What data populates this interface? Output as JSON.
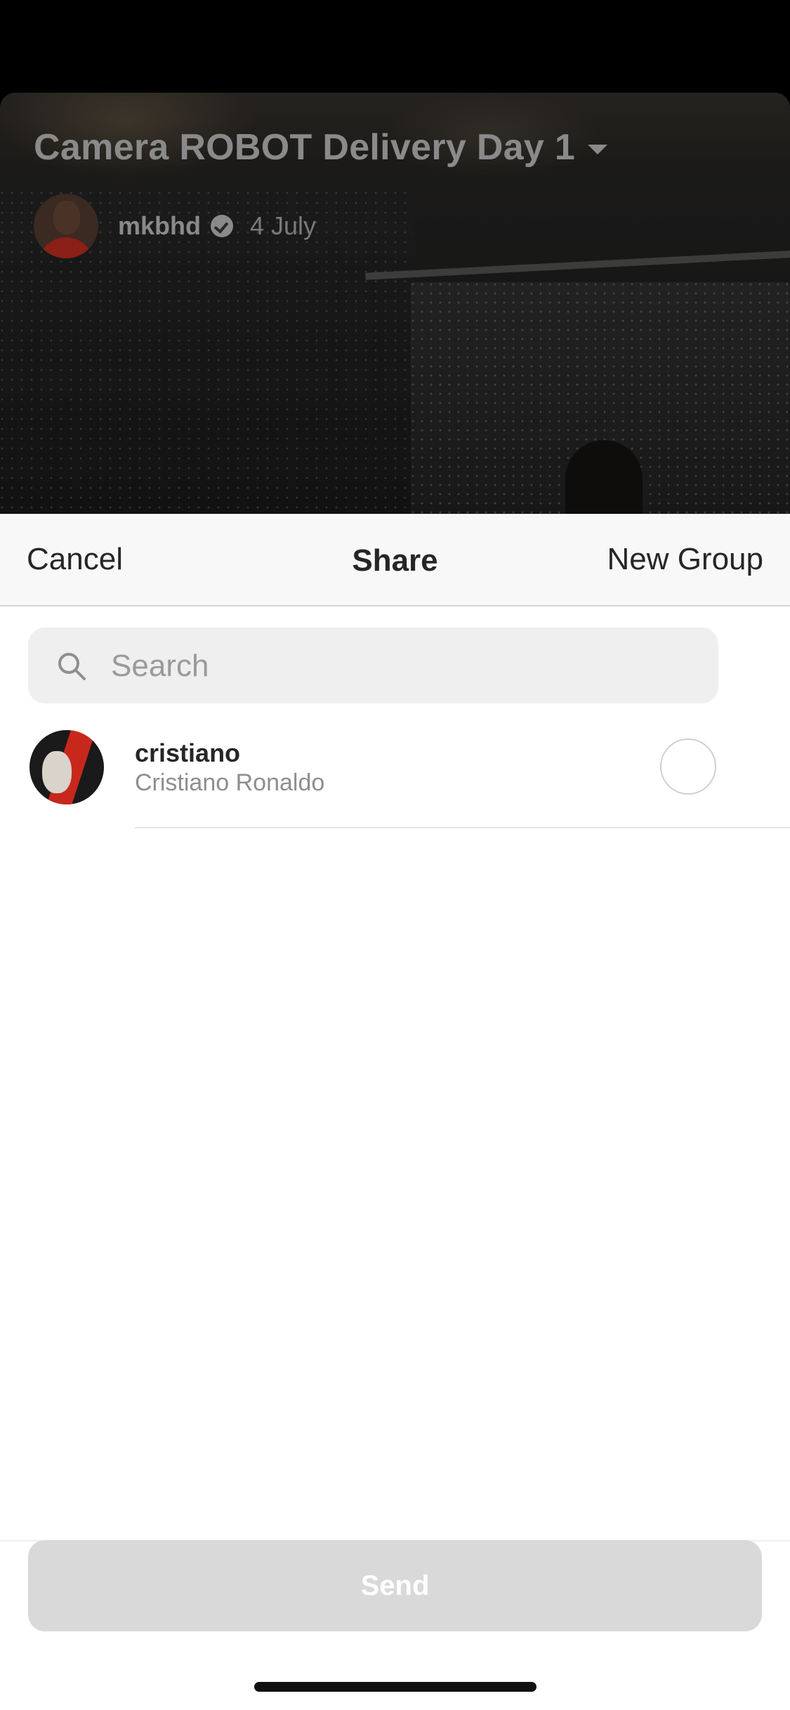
{
  "background": {
    "video_title": "Camera ROBOT Delivery Day 1",
    "author": {
      "username": "mkbhd",
      "verified": true,
      "date": "4 July"
    }
  },
  "share_sheet": {
    "cancel_label": "Cancel",
    "title": "Share",
    "new_group_label": "New Group",
    "search": {
      "placeholder": "Search",
      "value": ""
    },
    "results": [
      {
        "username": "cristiano",
        "full_name": "Cristiano Ronaldo",
        "selected": false
      }
    ],
    "send_label": "Send",
    "send_enabled": false
  },
  "colors": {
    "text_primary": "#262626",
    "text_secondary": "#8e8e8e",
    "search_bg": "#efefef",
    "send_disabled_bg": "#d9d9d9",
    "avatar_accent": "#c8281c"
  },
  "icons": {
    "search": "search-icon",
    "verified": "verified-badge-icon",
    "dropdown": "chevron-down-icon"
  }
}
